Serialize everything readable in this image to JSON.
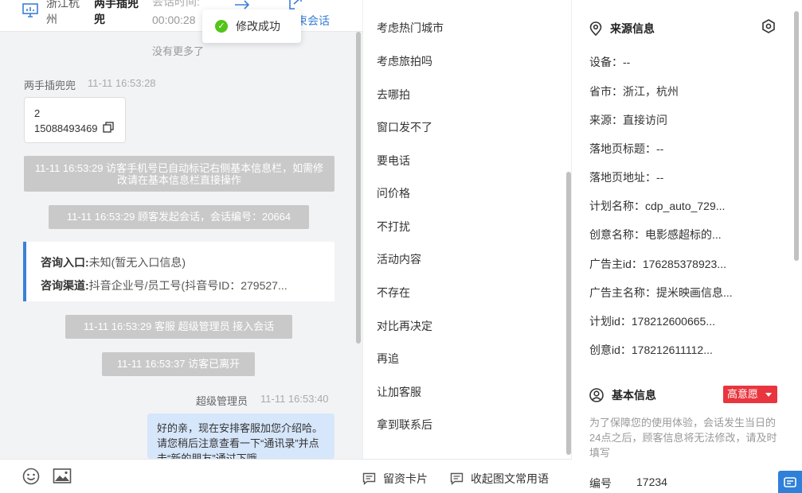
{
  "header": {
    "location": "浙江杭州",
    "visitor_name": "两手插兜兜",
    "time_label": "会话时间:",
    "duration": "00:00:28",
    "end_session": "束会话"
  },
  "toast": {
    "text": "修改成功"
  },
  "chat": {
    "no_more": "没有更多了",
    "msg1": {
      "sender": "两手插兜兜",
      "time": "11-11 16:53:28",
      "line1": "2",
      "line2": "15088493469"
    },
    "sys1": "11-11 16:53:29 访客手机号已自动标记右侧基本信息栏，如需修改请在基本信息栏直接操作",
    "sys2": "11-11 16:53:29 顾客发起会话，会话编号：20664",
    "consult": {
      "entry_label": "咨询入口:",
      "entry_value": "未知(暂无入口信息)",
      "channel_label": "咨询渠道:",
      "channel_value": "抖音企业号/员工号(抖音号ID：279527..."
    },
    "sys3": "11-11 16:53:29 客服 超级管理员 接入会话",
    "sys4": "11-11 16:53:37 访客已离开",
    "msg2": {
      "sender": "超级管理员",
      "time": "11-11 16:53:40",
      "text": "好的亲，现在安排客服加您介绍哈。请您稍后注意查看一下“通讯录”并点击“新的朋友”通过下哦"
    }
  },
  "phrases": [
    "考虑热门城市",
    "考虑旅拍吗",
    "去哪拍",
    "窗口发不了",
    "要电话",
    "问价格",
    "不打扰",
    "活动内容",
    "不存在",
    "对比再决定",
    "再追",
    "让加客服",
    "拿到联系后"
  ],
  "toolbar": {
    "card_btn": "留资卡片",
    "collapse_btn": "收起图文常用语"
  },
  "source": {
    "title": "来源信息",
    "rows": [
      "设备：--",
      "省市：浙江，杭州",
      "来源：直接访问",
      "落地页标题：--",
      "落地页地址：--",
      "计划名称：cdp_auto_729...",
      "创意名称：电影感超标的...",
      "广告主id：176285378923...",
      "广告主名称：提米映画信息...",
      "计划id：178212600665...",
      "创意id：178212611112..."
    ]
  },
  "basic": {
    "title": "基本信息",
    "intent_badge": "高意愿",
    "notice": "为了保障您的使用体验，会话发生当日的24点之后，顾客信息将无法修改，请及时填写",
    "id_label": "编号",
    "id_value": "17234"
  },
  "colors": {
    "accent": "#3b7fd9",
    "badge": "#e8353e",
    "success": "#52c41a",
    "system_msg": "#c9c9c9",
    "bubble": "#d6e6fb"
  }
}
